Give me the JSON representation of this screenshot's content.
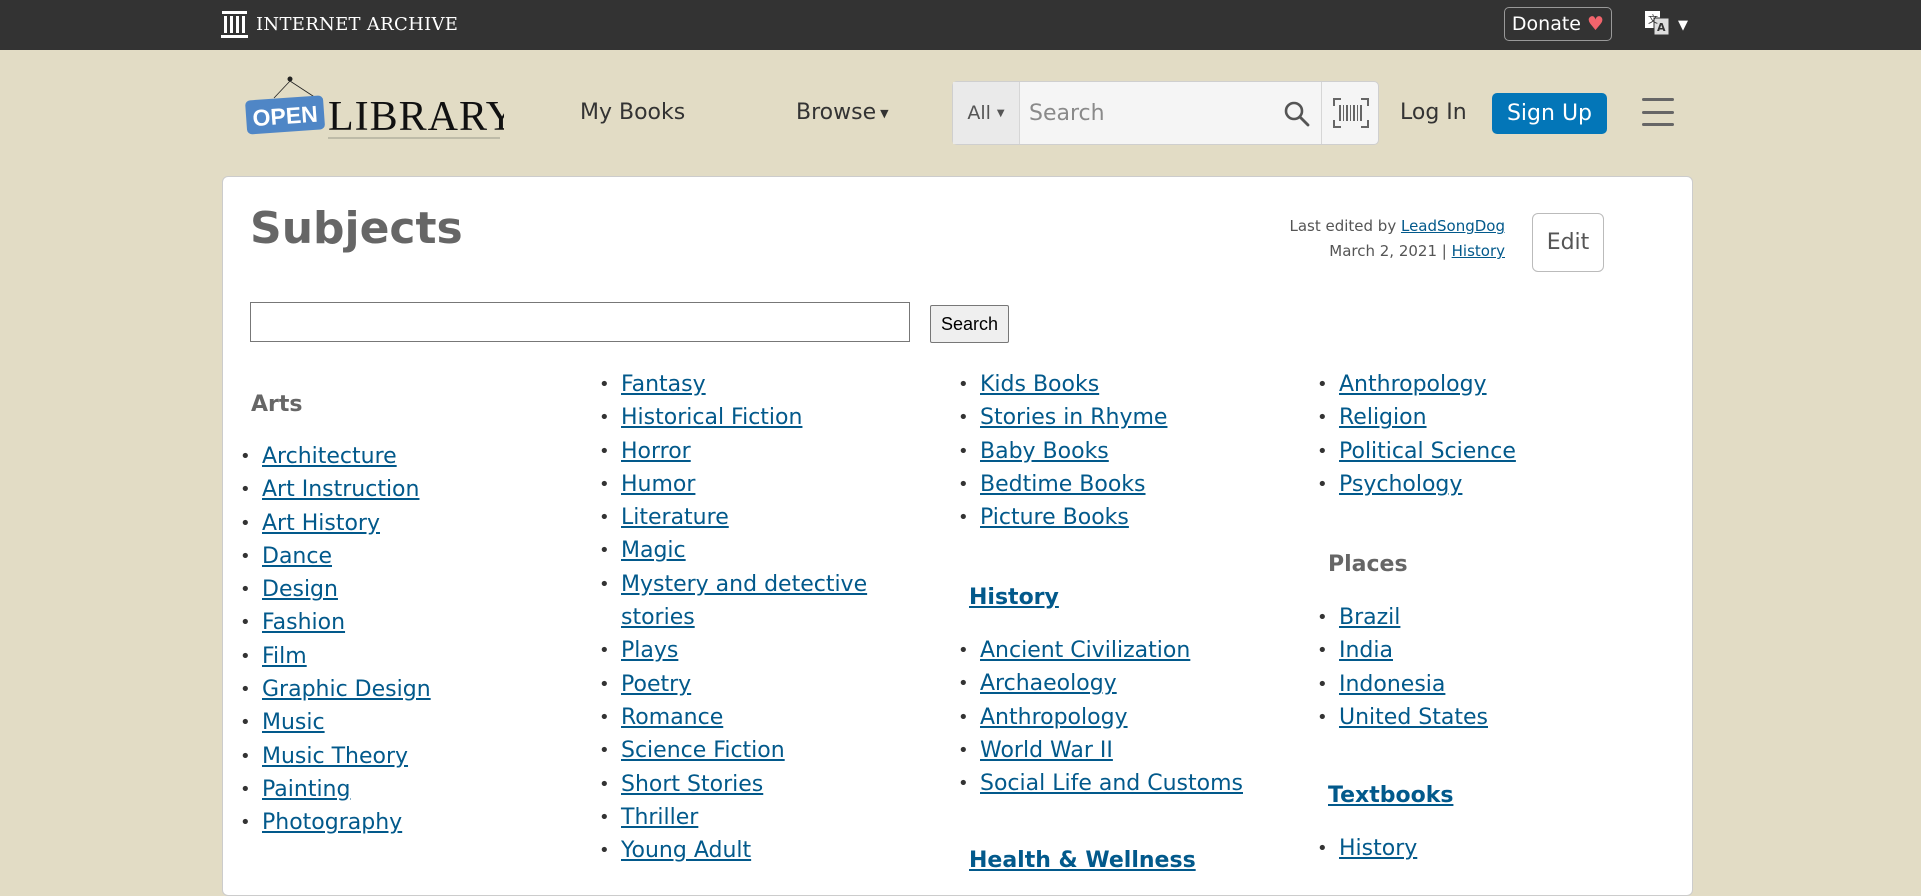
{
  "ia_bar": {
    "logo_text": "INTERNET ARCHIVE",
    "donate_label": "Donate",
    "donate_heart": "♥",
    "language_icon": "translate-icon"
  },
  "header": {
    "logo_open": "OPEN",
    "logo_library": "LIBRARY",
    "my_books": "My Books",
    "browse": "Browse",
    "search_scope": "All",
    "search_placeholder": "Search",
    "login": "Log In",
    "signup": "Sign Up"
  },
  "page": {
    "title": "Subjects",
    "last_edited_prefix": "Last edited by",
    "last_edited_user": "LeadSongDog",
    "last_edited_date": "March 2, 2021",
    "separator": "|",
    "history_link": "History",
    "edit_label": "Edit",
    "search_button": "Search"
  },
  "columns": {
    "col1": {
      "heading": "Arts",
      "items": [
        "Architecture",
        "Art Instruction",
        "Art History",
        "Dance",
        "Design",
        "Fashion",
        "Film",
        "Graphic Design",
        "Music",
        "Music Theory",
        "Painting",
        "Photography"
      ]
    },
    "col2": {
      "items": [
        "Fantasy",
        "Historical Fiction",
        "Horror",
        "Humor",
        "Literature",
        "Magic",
        "Mystery and detective",
        "stories",
        "Plays",
        "Poetry",
        "Romance",
        "Science Fiction",
        "Short Stories",
        "Thriller",
        "Young Adult"
      ]
    },
    "col3": {
      "items_top": [
        "Kids Books",
        "Stories in Rhyme",
        "Baby Books",
        "Bedtime Books",
        "Picture Books"
      ],
      "history_heading": "History",
      "history_items": [
        "Ancient Civilization",
        "Archaeology",
        "Anthropology",
        "World War II",
        "Social Life and Customs"
      ],
      "next_heading": "Health & Wellness"
    },
    "col4": {
      "items_top": [
        "Anthropology",
        "Religion",
        "Political Science",
        "Psychology"
      ],
      "places_heading": "Places",
      "places_items": [
        "Brazil",
        "India",
        "Indonesia",
        "United States"
      ],
      "textbooks_heading": "Textbooks",
      "textbooks_items": [
        "History"
      ]
    }
  }
}
